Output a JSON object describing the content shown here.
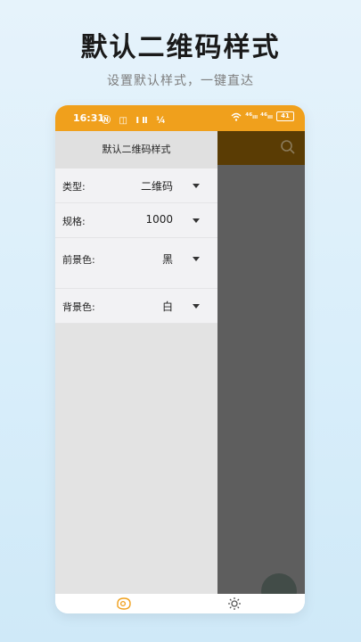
{
  "promo": {
    "title": "默认二维码样式",
    "subtitle": "设置默认样式，一键直达"
  },
  "statusbar": {
    "time": "16:31",
    "left_icons": "Ⓝ ◫ ⅠⅡ ¼",
    "network": "⁴⁶ᵢₗₗ ⁴⁶ᵢₗₗ",
    "battery": "41"
  },
  "drawer": {
    "title": "默认二维码样式",
    "rows": [
      {
        "label": "类型:",
        "value": "二维码"
      },
      {
        "label": "规格:",
        "value": "1000"
      },
      {
        "label": "前景色:",
        "value": "黑"
      },
      {
        "label": "背景色:",
        "value": "白"
      }
    ]
  },
  "icons": {
    "search": "search-icon",
    "home": "home-icon",
    "settings": "gear-icon"
  },
  "colors": {
    "statusbar": "#f0a01c",
    "app_bar_dimmed": "#5a3c04",
    "content_dimmed": "#5e5e5e",
    "nav_accent": "#f0a01c"
  }
}
